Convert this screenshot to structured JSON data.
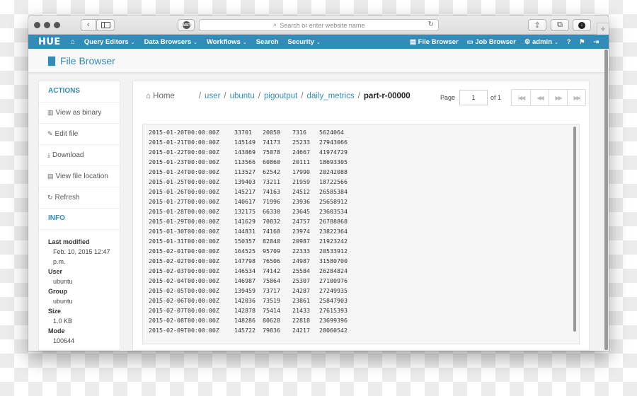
{
  "browser": {
    "url_placeholder": "Search or enter website name",
    "back_glyph": "‹",
    "forward_glyph": "›",
    "abp_label": "ABP",
    "new_tab_glyph": "+",
    "icons": {
      "search": "magnifier-icon",
      "reload": "reload-icon",
      "share": "share-icon",
      "tabs": "tabs-icon",
      "download": "download-icon"
    }
  },
  "navbar": {
    "logo": "HUE",
    "home_glyph": "⌂",
    "items": [
      {
        "label": "Query Editors",
        "dropdown": true
      },
      {
        "label": "Data Browsers",
        "dropdown": true
      },
      {
        "label": "Workflows",
        "dropdown": true
      },
      {
        "label": "Search",
        "dropdown": false
      },
      {
        "label": "Security",
        "dropdown": true
      }
    ],
    "right_items": [
      {
        "label": "File Browser",
        "icon": "file-icon"
      },
      {
        "label": "Job Browser",
        "icon": "job-icon"
      },
      {
        "label": "admin",
        "icon": "cogs-icon",
        "dropdown": true
      }
    ],
    "right_icons": [
      "help-icon",
      "flag-icon",
      "logout-icon"
    ],
    "chevron": "⌄",
    "colors": {
      "background": "#338bb8",
      "text": "#ffffff"
    }
  },
  "page": {
    "title": "File Browser"
  },
  "sidebar": {
    "actions_header": "ACTIONS",
    "actions": [
      {
        "label": "View as binary",
        "icon": "binary-icon",
        "glyph": "▥"
      },
      {
        "label": "Edit file",
        "icon": "pencil-icon",
        "glyph": "✎"
      },
      {
        "label": "Download",
        "icon": "download-icon",
        "glyph": "⤓"
      },
      {
        "label": "View file location",
        "icon": "file-icon",
        "glyph": "▤"
      },
      {
        "label": "Refresh",
        "icon": "refresh-icon",
        "glyph": "↻"
      }
    ],
    "info_header": "INFO",
    "info": {
      "last_modified_label": "Last modified",
      "last_modified_value": "Feb. 10, 2015 12:47",
      "last_modified_value_cont": "p.m.",
      "user_label": "User",
      "user_value": "ubuntu",
      "group_label": "Group",
      "group_value": "ubuntu",
      "size_label": "Size",
      "size_value": "1.0 KB",
      "mode_label": "Mode",
      "mode_value": "100644"
    }
  },
  "breadcrumb": {
    "home": "Home",
    "separator": "/",
    "links": [
      "user",
      "ubuntu",
      "pigoutput",
      "daily_metrics"
    ],
    "current": "part-r-00000"
  },
  "pager": {
    "label": "Page",
    "current_page": "1",
    "of_label": "of 1",
    "buttons": [
      "first-page",
      "previous-page",
      "next-page",
      "last-page"
    ],
    "glyphs": [
      "|◀◀",
      "◀◀",
      "▶▶",
      "▶▶|"
    ]
  },
  "file_contents": {
    "rows": [
      [
        "2015-01-20T00:00:00Z",
        "33701",
        "20058",
        "7316",
        "5624064"
      ],
      [
        "2015-01-21T00:00:00Z",
        "145149",
        "74173",
        "25233",
        "27943066"
      ],
      [
        "2015-01-22T00:00:00Z",
        "143869",
        "75078",
        "24667",
        "41974729"
      ],
      [
        "2015-01-23T00:00:00Z",
        "113566",
        "60860",
        "20111",
        "18693305"
      ],
      [
        "2015-01-24T00:00:00Z",
        "113527",
        "62542",
        "17990",
        "20242088"
      ],
      [
        "2015-01-25T00:00:00Z",
        "139403",
        "73211",
        "21959",
        "18722566"
      ],
      [
        "2015-01-26T00:00:00Z",
        "145217",
        "74163",
        "24512",
        "26585384"
      ],
      [
        "2015-01-27T00:00:00Z",
        "140617",
        "71996",
        "23936",
        "25658912"
      ],
      [
        "2015-01-28T00:00:00Z",
        "132175",
        "66330",
        "23645",
        "23603534"
      ],
      [
        "2015-01-29T00:00:00Z",
        "141629",
        "70832",
        "24757",
        "26788868"
      ],
      [
        "2015-01-30T00:00:00Z",
        "144831",
        "74168",
        "23974",
        "23822364"
      ],
      [
        "2015-01-31T00:00:00Z",
        "150357",
        "82840",
        "20987",
        "21923242"
      ],
      [
        "2015-02-01T00:00:00Z",
        "164525",
        "95709",
        "22333",
        "20533912"
      ],
      [
        "2015-02-02T00:00:00Z",
        "147798",
        "76506",
        "24987",
        "31580700"
      ],
      [
        "2015-02-03T00:00:00Z",
        "146534",
        "74142",
        "25584",
        "26284824"
      ],
      [
        "2015-02-04T00:00:00Z",
        "146987",
        "75864",
        "25307",
        "27100976"
      ],
      [
        "2015-02-05T00:00:00Z",
        "139459",
        "73717",
        "24287",
        "27249935"
      ],
      [
        "2015-02-06T00:00:00Z",
        "142036",
        "73519",
        "23861",
        "25847903"
      ],
      [
        "2015-02-07T00:00:00Z",
        "142878",
        "75414",
        "21433",
        "27615393"
      ],
      [
        "2015-02-08T00:00:00Z",
        "148286",
        "80628",
        "22818",
        "23699396"
      ],
      [
        "2015-02-09T00:00:00Z",
        "145722",
        "79836",
        "24217",
        "28060542"
      ]
    ]
  }
}
